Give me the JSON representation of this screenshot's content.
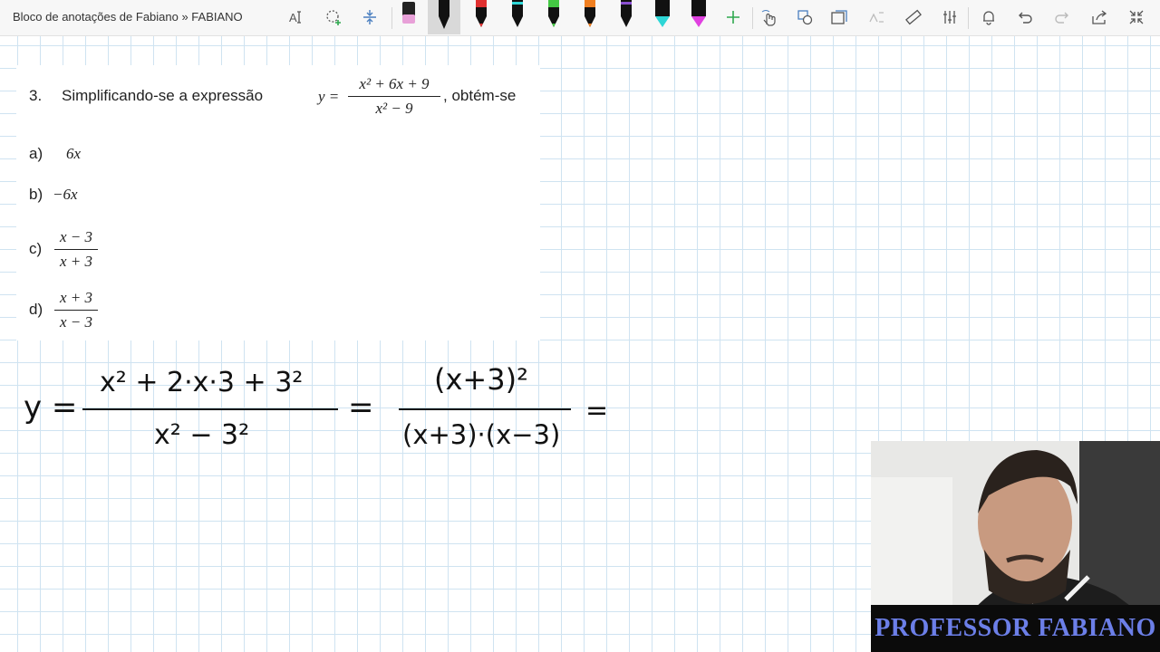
{
  "window": {
    "title": "Bloco de anotações de Fabiano » FABIANO"
  },
  "toolbar": {
    "tools": [
      "text-select-icon",
      "lasso-select-icon",
      "insert-space-icon",
      "highlighter-icon",
      "pen-black-icon",
      "pen-red-icon",
      "pen-black-2-icon",
      "pen-green-icon",
      "pen-orange-icon",
      "pen-black-3-icon",
      "pen-cyan-icon",
      "pen-magenta-icon",
      "add-pen-icon",
      "touch-draw-icon",
      "shapes-icon",
      "convert-ink-icon",
      "ink-to-math-icon",
      "ruler-icon",
      "adjust-icon",
      "bell-icon",
      "undo-icon",
      "redo-icon",
      "share-icon",
      "collapse-icon"
    ],
    "pen_colors": [
      "#e8a0d8",
      "#111111",
      "#e03030",
      "#111111",
      "#44c844",
      "#f07f20",
      "#111111",
      "#2ed6d6",
      "#e040e0"
    ]
  },
  "question": {
    "number": "3.",
    "prompt": "Simplificando-se a expressão",
    "y_eq": "y =",
    "numerator": "x² + 6x + 9",
    "denominator": "x² − 9",
    "suffix": ", obtém-se",
    "options": [
      {
        "label": "a)",
        "value": "6x"
      },
      {
        "label": "b)",
        "value": "−6x"
      },
      {
        "label": "c)",
        "num": "x − 3",
        "den": "x + 3"
      },
      {
        "label": "d)",
        "num": "x + 3",
        "den": "x − 3"
      }
    ]
  },
  "handwriting": {
    "y_eq": "y =",
    "num1": "x² + 2·x·3 + 3²",
    "den1": "x² − 3²",
    "eq2": "=",
    "num2": "(x+3)²",
    "den2": "(x+3)·(x−3)",
    "eq3": "="
  },
  "webcam": {
    "banner": "PROFESSOR FABIANO"
  }
}
